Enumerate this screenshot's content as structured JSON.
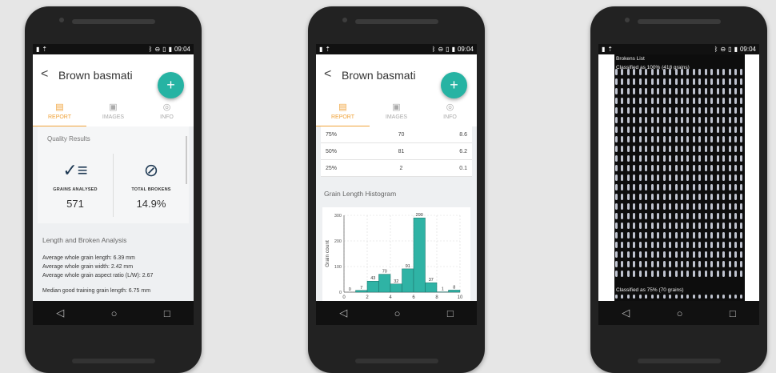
{
  "status": {
    "time": "09:04",
    "left_icons": [
      "notification-icon",
      "upload-icon"
    ],
    "right_icons": [
      "bluetooth-icon",
      "dnd-icon",
      "vibrate-icon",
      "battery-icon"
    ]
  },
  "app": {
    "title": "Brown basmati",
    "fab_label": "+"
  },
  "tabs": [
    {
      "label": "REPORT",
      "icon": "report-icon"
    },
    {
      "label": "IMAGES",
      "icon": "images-icon"
    },
    {
      "label": "INFO",
      "icon": "info-icon"
    }
  ],
  "report": {
    "quality_title": "Quality Results",
    "grains_label": "GRAINS ANALYSED",
    "grains_value": "571",
    "brokens_label": "TOTAL BROKENS",
    "brokens_value": "14.9%",
    "length_title": "Length and Broken Analysis",
    "lines": [
      "Average whole grain length: 6.39 mm",
      "Average whole grain width: 2.42 mm",
      "Average whole grain aspect ratio (L/W): 2.67"
    ],
    "median_line": "Median good training grain length: 6.75 mm"
  },
  "stats_rows": [
    [
      "75%",
      "70",
      "8.6"
    ],
    [
      "50%",
      "81",
      "6.2"
    ],
    [
      "25%",
      "2",
      "0.1"
    ]
  ],
  "histogram_title": "Grain Length Histogram",
  "chart_data": {
    "type": "bar",
    "title": "",
    "xlabel": "Length (mm)",
    "ylabel": "Grain count",
    "x": [
      1,
      2,
      3,
      4,
      5,
      6,
      7,
      8,
      9
    ],
    "values": [
      0,
      7,
      43,
      70,
      32,
      91,
      290,
      37,
      1,
      8
    ],
    "bins": [
      [
        0,
        1
      ],
      [
        1,
        2
      ],
      [
        2,
        3
      ],
      [
        3,
        4
      ],
      [
        4,
        5
      ],
      [
        5,
        6
      ],
      [
        6,
        7
      ],
      [
        7,
        8
      ],
      [
        8,
        9
      ],
      [
        9,
        10
      ]
    ],
    "xlim": [
      0,
      10
    ],
    "ylim": [
      0,
      300
    ],
    "xticks": [
      "0",
      "2",
      "4",
      "6",
      "8",
      "10"
    ],
    "yticks": [
      "0",
      "100",
      "200",
      "300"
    ],
    "grid": true,
    "color": "#2fb3a5"
  },
  "brokens": {
    "title": "Brokens List",
    "class100": "Classified as 100% (418 grains)",
    "class75": "Classified as 75% (70 grains)"
  },
  "nav": {
    "back": "◁",
    "home": "○",
    "recent": "□"
  },
  "colors": {
    "accent": "#f0a33a",
    "fab": "#26b3a3",
    "bar": "#2fb3a5",
    "dark_icon": "#1f3a54"
  }
}
